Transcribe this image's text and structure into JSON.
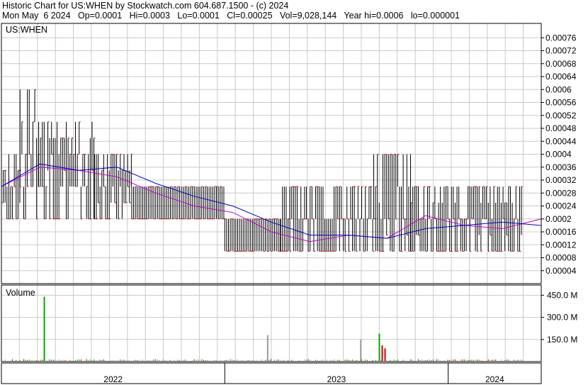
{
  "header": {
    "line1": "Historic Chart for US:WHEN by Stockwatch.com 604.687.1500 - (c) 2024",
    "line2": "Mon May  6 2024   Op=0.0001   Hi=0.0003   Lo=0.0001   Cl=0.00025   Vol=9,028,144   Year hi=0.0006   lo=0.000001"
  },
  "colors": {
    "price_bar": "#000000",
    "close_tick": "#cc0000",
    "ma_short": "#cc00cc",
    "ma_long": "#0000cc",
    "volume_up": "#00aa00",
    "volume_down": "#cc0000",
    "volume_flat": "#9a9a9a",
    "grid": "#c8c8c8"
  },
  "chart_data": [
    {
      "type": "bar",
      "subtype": "ohlc",
      "title": "US:WHEN",
      "ylim": [
        0,
        0.0008
      ],
      "y_ticks": [
        "0.00004",
        "0.00008",
        "0.00012",
        "0.00016",
        "0.0002",
        "0.00024",
        "0.00028",
        "0.00032",
        "0.00036",
        "0.0004",
        "0.00044",
        "0.00048",
        "0.00052",
        "0.00056",
        "0.0006",
        "0.00064",
        "0.00068",
        "0.00072",
        "0.00076"
      ],
      "x_labels": [
        "2022",
        "2023",
        "2024"
      ],
      "x_period": [
        "2022-01",
        "2024-05"
      ],
      "segments": [
        {
          "period": "2022-01 to 2022-02",
          "low": 0.0002,
          "high": 0.0004,
          "typical_close": 0.0003
        },
        {
          "period": "2022-02 to 2022-03",
          "low": 0.0002,
          "high": 0.0006,
          "typical_close": 0.0004
        },
        {
          "period": "2022-03 to 2022-06",
          "low": 0.0002,
          "high": 0.0005,
          "typical_close": 0.0004
        },
        {
          "period": "2022-06 to 2022-08",
          "low": 0.0002,
          "high": 0.0004,
          "typical_close": 0.0003
        },
        {
          "period": "2022-08 to 2023-01",
          "low": 0.0002,
          "high": 0.0003,
          "typical_close": 0.00025
        },
        {
          "period": "2023-01 to 2023-04",
          "low": 0.0001,
          "high": 0.0002,
          "typical_close": 0.00015
        },
        {
          "period": "2023-04 to 2023-09",
          "low": 0.0001,
          "high": 0.0003,
          "typical_close": 0.00015
        },
        {
          "period": "2023-09 to 2023-11",
          "low": 0.0001,
          "high": 0.0004,
          "typical_close": 0.0002
        },
        {
          "period": "2023-11 to 2024-05",
          "low": 0.0001,
          "high": 0.0003,
          "typical_close": 0.0002
        }
      ],
      "moving_averages": [
        {
          "values": [
            0.0003,
            0.00036,
            0.00035,
            0.00033,
            0.00028,
            0.00024,
            0.00022,
            0.00016,
            0.00013,
            0.00015,
            0.00014,
            0.00021,
            0.00018,
            0.00017,
            0.0002
          ]
        },
        {
          "values": [
            0.0003,
            0.00037,
            0.00035,
            0.00036,
            0.00031,
            0.00027,
            0.00024,
            0.00019,
            0.00015,
            0.00015,
            0.00014,
            0.00017,
            0.00018,
            0.00019,
            0.00018
          ]
        }
      ]
    },
    {
      "type": "bar",
      "title": "Volume",
      "ylim": [
        0,
        500000000
      ],
      "y_ticks": [
        "150.0 M",
        "300.0 M",
        "450.0 M"
      ],
      "x_labels": [
        "2022",
        "2023",
        "2024"
      ],
      "notable_bars": [
        {
          "date": "2022-03",
          "value": 440000000,
          "direction": "up"
        },
        {
          "date": "2023-03",
          "value": 180000000,
          "direction": "flat"
        },
        {
          "date": "2023-08",
          "value": 150000000,
          "direction": "flat"
        },
        {
          "date": "2023-09",
          "value": 190000000,
          "direction": "up"
        },
        {
          "date": "2023-09",
          "value": 110000000,
          "direction": "down"
        },
        {
          "date": "2023-09",
          "value": 90000000,
          "direction": "down"
        }
      ],
      "typical_daily_volume": 10000000
    }
  ]
}
